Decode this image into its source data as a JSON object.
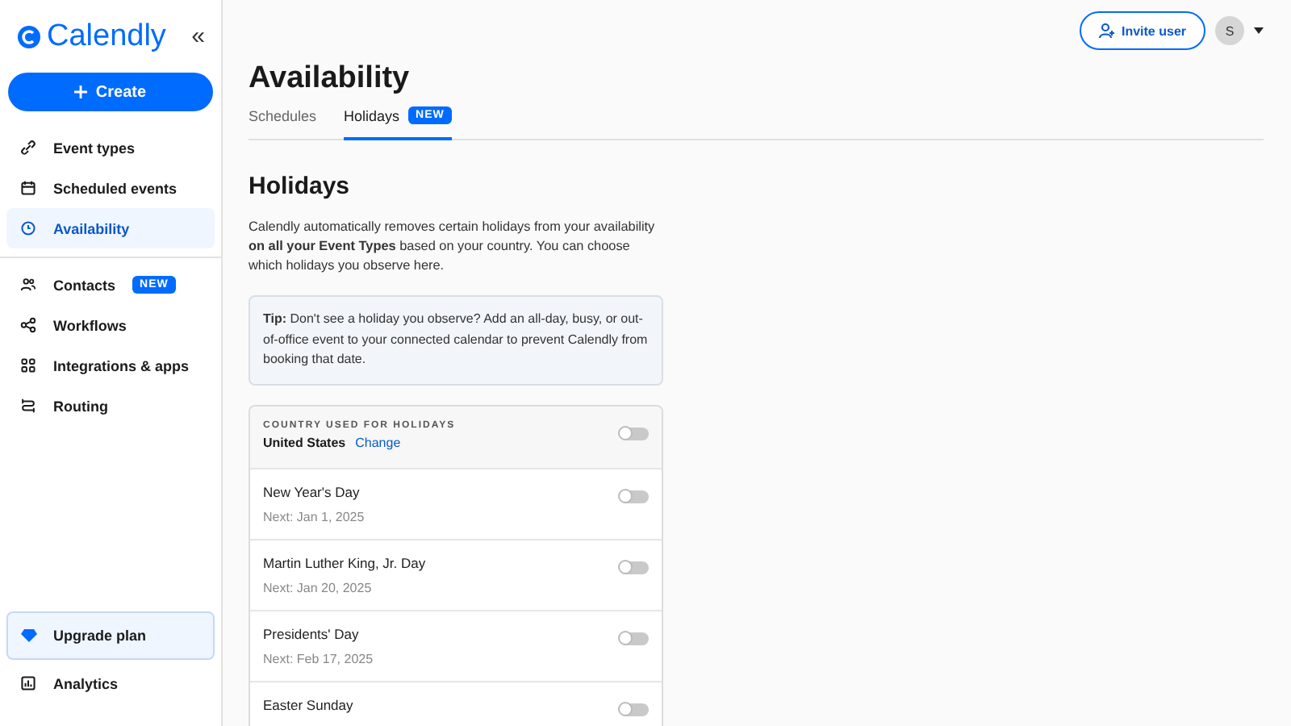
{
  "sidebar": {
    "logo": "Calendly",
    "collapse": "«",
    "create_button": "Create",
    "items": [
      {
        "label": "Event types",
        "kind": "link",
        "selected": false
      },
      {
        "label": "Scheduled events",
        "kind": "calendar",
        "selected": false
      },
      {
        "label": "Availability",
        "kind": "clock",
        "selected": true
      }
    ],
    "items_2": [
      {
        "label": "Contacts",
        "kind": "people",
        "selected": false,
        "badge": "NEW"
      },
      {
        "label": "Workflows",
        "kind": "share",
        "selected": false
      },
      {
        "label": "Integrations & apps",
        "kind": "grid",
        "selected": false
      },
      {
        "label": "Routing",
        "kind": "route",
        "selected": false
      }
    ],
    "upgrade": "Upgrade plan",
    "bottom_items": [
      {
        "label": "Analytics",
        "kind": "chart",
        "selected": false
      }
    ]
  },
  "header": {
    "invite_button": "Invite user",
    "avatar": "S"
  },
  "page": {
    "title": "Availability",
    "tabs": [
      {
        "label": "Schedules",
        "selected": false
      },
      {
        "label": "Holidays",
        "selected": true,
        "badge": "NEW"
      }
    ],
    "section_title": "Holidays",
    "description": "Calendly automatically removes certain holidays from your availability **on all your Event Types** based on your country. You can choose which holidays you observe here.",
    "tip": "**Tip:** Don't see a holiday you observe? Add an all-day, busy, or out-of-office event to your connected calendar to prevent Calendly from booking that date.",
    "country": {
      "label": "COUNTRY USED FOR HOLIDAYS",
      "value": "United States",
      "link": "Change",
      "on": false
    },
    "holidays": [
      {
        "name": "New Year's Day",
        "next": "Next: Jan 1, 2025",
        "on": false
      },
      {
        "name": "Martin Luther King, Jr. Day",
        "next": "Next: Jan 20, 2025",
        "on": false
      },
      {
        "name": "Presidents' Day",
        "next": "Next: Feb 17, 2025",
        "on": false
      },
      {
        "name": "Easter Sunday",
        "on": false
      }
    ]
  }
}
